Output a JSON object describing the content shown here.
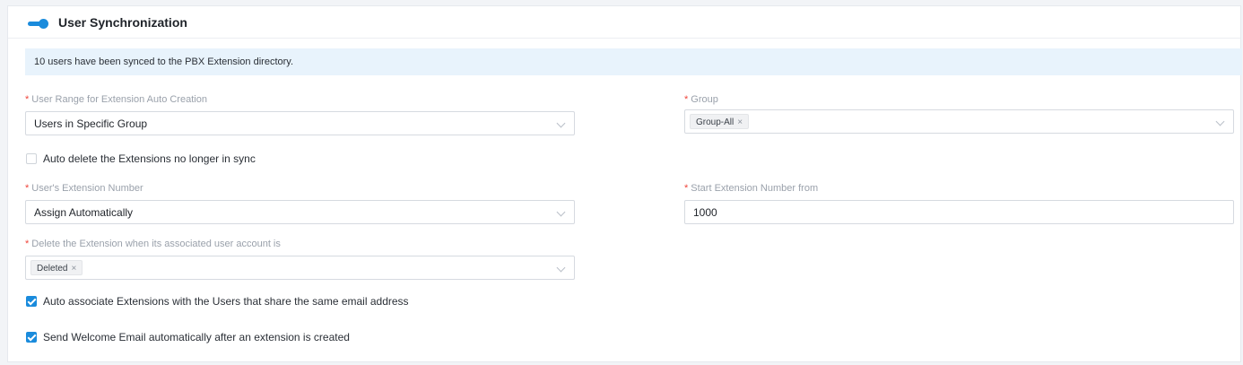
{
  "section": {
    "title": "User Synchronization",
    "toggle_on": true
  },
  "notice": "10 users have been synced to the PBX Extension directory.",
  "fields": {
    "user_range": {
      "label": "User Range for Extension Auto Creation",
      "value": "Users in Specific Group"
    },
    "group": {
      "label": "Group",
      "tags": [
        "Group-All"
      ]
    },
    "auto_delete": {
      "label": "Auto delete the Extensions no longer in sync",
      "checked": false
    },
    "extension_number": {
      "label": "User's Extension Number",
      "value": "Assign Automatically"
    },
    "start_extension": {
      "label": "Start Extension Number from",
      "value": "1000"
    },
    "delete_when": {
      "label": "Delete the Extension when its associated user account is",
      "tags": [
        "Deleted"
      ]
    },
    "auto_associate": {
      "label": "Auto associate Extensions with the Users that share the same email address",
      "checked": true
    },
    "welcome_email": {
      "label": "Send Welcome Email automatically after an extension is created",
      "checked": true
    }
  },
  "tag_remove_glyph": "×",
  "required_mark": "*",
  "colors": {
    "accent": "#1a8bdc",
    "required": "#f0443a",
    "notice_bg": "#e8f3fc"
  }
}
